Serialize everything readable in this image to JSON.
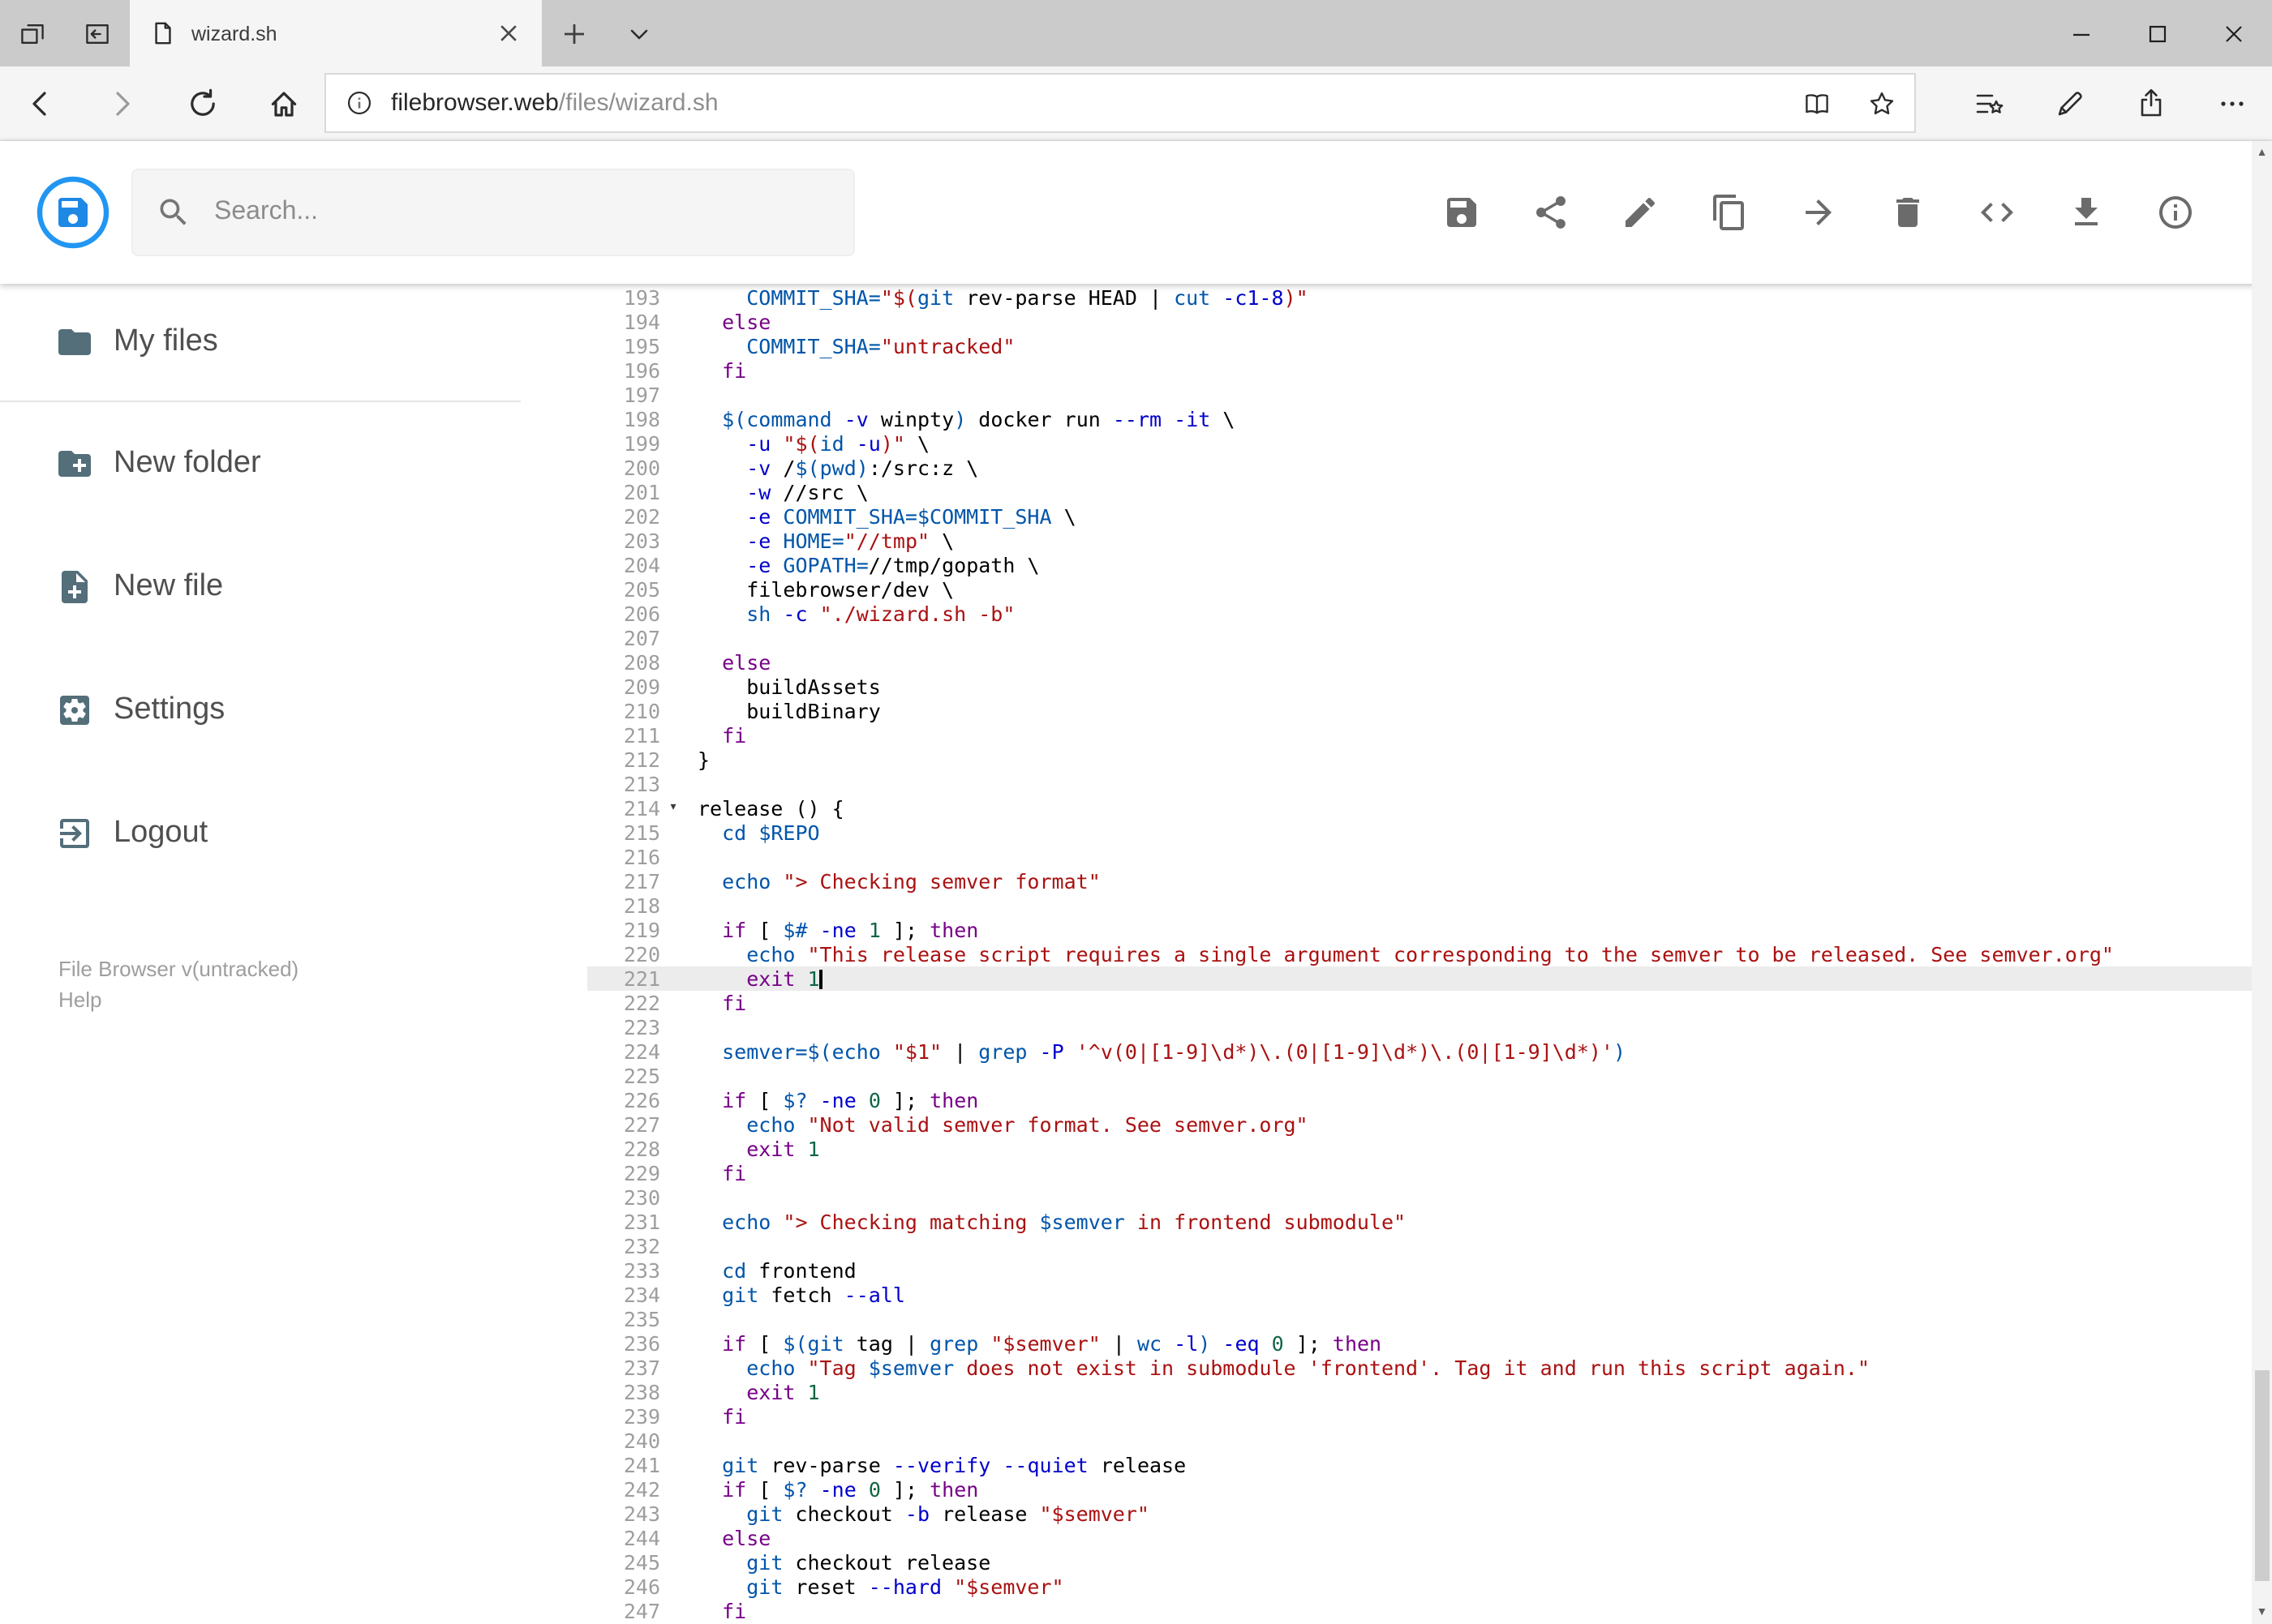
{
  "browser": {
    "tab_title": "wizard.sh",
    "url_host": "filebrowser.web",
    "url_path": "/files/wizard.sh"
  },
  "header": {
    "search_placeholder": "Search..."
  },
  "toolbar": {
    "icons": [
      "save",
      "share",
      "edit",
      "copy",
      "move",
      "delete",
      "code",
      "download",
      "info"
    ]
  },
  "sidebar": {
    "items": [
      {
        "label": "My files",
        "icon": "folder",
        "divider_after": true
      },
      {
        "label": "New folder",
        "icon": "create-new-folder",
        "divider_after": false
      },
      {
        "label": "New file",
        "icon": "note-add",
        "divider_after": false
      },
      {
        "label": "Settings",
        "icon": "settings",
        "divider_after": false
      },
      {
        "label": "Logout",
        "icon": "logout",
        "divider_after": false
      }
    ],
    "footer": {
      "version": "File Browser v(untracked)",
      "help": "Help"
    }
  },
  "colors": {
    "brand_blue": "#2196f3",
    "active_line_bg": "#ececec"
  },
  "editor": {
    "active_line": 221,
    "fold_line": 214,
    "cursor_line": 221,
    "lines": [
      {
        "n": 193,
        "t": [
          [
            "pl",
            "    "
          ],
          [
            "vr",
            "COMMIT_SHA="
          ],
          [
            "st",
            "\"$("
          ],
          [
            "bi",
            "git"
          ],
          [
            "pl",
            " rev-parse HEAD | "
          ],
          [
            "bi",
            "cut"
          ],
          [
            "pl",
            " "
          ],
          [
            "at",
            "-c1-8"
          ],
          [
            "st",
            ")\""
          ]
        ]
      },
      {
        "n": 194,
        "t": [
          [
            "pl",
            "  "
          ],
          [
            "kw",
            "else"
          ]
        ]
      },
      {
        "n": 195,
        "t": [
          [
            "pl",
            "    "
          ],
          [
            "vr",
            "COMMIT_SHA="
          ],
          [
            "st",
            "\"untracked\""
          ]
        ]
      },
      {
        "n": 196,
        "t": [
          [
            "pl",
            "  "
          ],
          [
            "kw",
            "fi"
          ]
        ]
      },
      {
        "n": 197,
        "t": []
      },
      {
        "n": 198,
        "t": [
          [
            "pl",
            "  "
          ],
          [
            "vr",
            "$("
          ],
          [
            "bi",
            "command"
          ],
          [
            "pl",
            " "
          ],
          [
            "at",
            "-v"
          ],
          [
            "pl",
            " winpty"
          ],
          [
            "vr",
            ")"
          ],
          [
            "pl",
            " docker run "
          ],
          [
            "at",
            "--rm"
          ],
          [
            "pl",
            " "
          ],
          [
            "at",
            "-it"
          ],
          [
            "pl",
            " \\"
          ]
        ]
      },
      {
        "n": 199,
        "t": [
          [
            "pl",
            "    "
          ],
          [
            "at",
            "-u"
          ],
          [
            "pl",
            " "
          ],
          [
            "st",
            "\"$("
          ],
          [
            "bi",
            "id"
          ],
          [
            "pl",
            " "
          ],
          [
            "at",
            "-u"
          ],
          [
            "st",
            ")\""
          ],
          [
            "pl",
            " \\"
          ]
        ]
      },
      {
        "n": 200,
        "t": [
          [
            "pl",
            "    "
          ],
          [
            "at",
            "-v"
          ],
          [
            "pl",
            " /"
          ],
          [
            "vr",
            "$("
          ],
          [
            "bi",
            "pwd"
          ],
          [
            "vr",
            ")"
          ],
          [
            "pl",
            ":/src:z \\"
          ]
        ]
      },
      {
        "n": 201,
        "t": [
          [
            "pl",
            "    "
          ],
          [
            "at",
            "-w"
          ],
          [
            "pl",
            " //src \\"
          ]
        ]
      },
      {
        "n": 202,
        "t": [
          [
            "pl",
            "    "
          ],
          [
            "at",
            "-e"
          ],
          [
            "pl",
            " "
          ],
          [
            "vr",
            "COMMIT_SHA=$COMMIT_SHA"
          ],
          [
            "pl",
            " \\"
          ]
        ]
      },
      {
        "n": 203,
        "t": [
          [
            "pl",
            "    "
          ],
          [
            "at",
            "-e"
          ],
          [
            "pl",
            " "
          ],
          [
            "vr",
            "HOME="
          ],
          [
            "st",
            "\"//tmp\""
          ],
          [
            "pl",
            " \\"
          ]
        ]
      },
      {
        "n": 204,
        "t": [
          [
            "pl",
            "    "
          ],
          [
            "at",
            "-e"
          ],
          [
            "pl",
            " "
          ],
          [
            "vr",
            "GOPATH="
          ],
          [
            "pl",
            "//tmp/gopath \\"
          ]
        ]
      },
      {
        "n": 205,
        "t": [
          [
            "pl",
            "    filebrowser/dev \\"
          ]
        ]
      },
      {
        "n": 206,
        "t": [
          [
            "pl",
            "    "
          ],
          [
            "bi",
            "sh"
          ],
          [
            "pl",
            " "
          ],
          [
            "at",
            "-c"
          ],
          [
            "pl",
            " "
          ],
          [
            "st",
            "\"./wizard.sh -b\""
          ]
        ]
      },
      {
        "n": 207,
        "t": []
      },
      {
        "n": 208,
        "t": [
          [
            "pl",
            "  "
          ],
          [
            "kw",
            "else"
          ]
        ]
      },
      {
        "n": 209,
        "t": [
          [
            "pl",
            "    buildAssets"
          ]
        ]
      },
      {
        "n": 210,
        "t": [
          [
            "pl",
            "    buildBinary"
          ]
        ]
      },
      {
        "n": 211,
        "t": [
          [
            "pl",
            "  "
          ],
          [
            "kw",
            "fi"
          ]
        ]
      },
      {
        "n": 212,
        "t": [
          [
            "pl",
            "}"
          ]
        ]
      },
      {
        "n": 213,
        "t": []
      },
      {
        "n": 214,
        "t": [
          [
            "pl",
            "release () {"
          ]
        ]
      },
      {
        "n": 215,
        "t": [
          [
            "pl",
            "  "
          ],
          [
            "bi",
            "cd"
          ],
          [
            "pl",
            " "
          ],
          [
            "vr",
            "$REPO"
          ]
        ]
      },
      {
        "n": 216,
        "t": []
      },
      {
        "n": 217,
        "t": [
          [
            "pl",
            "  "
          ],
          [
            "bi",
            "echo"
          ],
          [
            "pl",
            " "
          ],
          [
            "st",
            "\"> Checking semver format\""
          ]
        ]
      },
      {
        "n": 218,
        "t": []
      },
      {
        "n": 219,
        "t": [
          [
            "pl",
            "  "
          ],
          [
            "kw",
            "if"
          ],
          [
            "pl",
            " [ "
          ],
          [
            "vr",
            "$#"
          ],
          [
            "pl",
            " "
          ],
          [
            "at",
            "-ne"
          ],
          [
            "pl",
            " "
          ],
          [
            "nu",
            "1"
          ],
          [
            "pl",
            " ]; "
          ],
          [
            "kw",
            "then"
          ]
        ]
      },
      {
        "n": 220,
        "t": [
          [
            "pl",
            "    "
          ],
          [
            "bi",
            "echo"
          ],
          [
            "pl",
            " "
          ],
          [
            "st",
            "\"This release script requires a single argument corresponding to the semver to be released. See semver.org\""
          ]
        ]
      },
      {
        "n": 221,
        "t": [
          [
            "pl",
            "    "
          ],
          [
            "kw",
            "exit"
          ],
          [
            "pl",
            " "
          ],
          [
            "nu",
            "1"
          ]
        ]
      },
      {
        "n": 222,
        "t": [
          [
            "pl",
            "  "
          ],
          [
            "kw",
            "fi"
          ]
        ]
      },
      {
        "n": 223,
        "t": []
      },
      {
        "n": 224,
        "t": [
          [
            "pl",
            "  "
          ],
          [
            "vr",
            "semver=$("
          ],
          [
            "bi",
            "echo"
          ],
          [
            "pl",
            " "
          ],
          [
            "st",
            "\"$1\""
          ],
          [
            "pl",
            " | "
          ],
          [
            "bi",
            "grep"
          ],
          [
            "pl",
            " "
          ],
          [
            "at",
            "-P"
          ],
          [
            "pl",
            " "
          ],
          [
            "st",
            "'^v(0|[1-9]\\d*)\\.(0|[1-9]\\d*)\\.(0|[1-9]\\d*)'"
          ],
          [
            "vr",
            ")"
          ]
        ]
      },
      {
        "n": 225,
        "t": []
      },
      {
        "n": 226,
        "t": [
          [
            "pl",
            "  "
          ],
          [
            "kw",
            "if"
          ],
          [
            "pl",
            " [ "
          ],
          [
            "vr",
            "$?"
          ],
          [
            "pl",
            " "
          ],
          [
            "at",
            "-ne"
          ],
          [
            "pl",
            " "
          ],
          [
            "nu",
            "0"
          ],
          [
            "pl",
            " ]; "
          ],
          [
            "kw",
            "then"
          ]
        ]
      },
      {
        "n": 227,
        "t": [
          [
            "pl",
            "    "
          ],
          [
            "bi",
            "echo"
          ],
          [
            "pl",
            " "
          ],
          [
            "st",
            "\"Not valid semver format. See semver.org\""
          ]
        ]
      },
      {
        "n": 228,
        "t": [
          [
            "pl",
            "    "
          ],
          [
            "kw",
            "exit"
          ],
          [
            "pl",
            " "
          ],
          [
            "nu",
            "1"
          ]
        ]
      },
      {
        "n": 229,
        "t": [
          [
            "pl",
            "  "
          ],
          [
            "kw",
            "fi"
          ]
        ]
      },
      {
        "n": 230,
        "t": []
      },
      {
        "n": 231,
        "t": [
          [
            "pl",
            "  "
          ],
          [
            "bi",
            "echo"
          ],
          [
            "pl",
            " "
          ],
          [
            "st",
            "\"> Checking matching "
          ],
          [
            "vr",
            "$semver"
          ],
          [
            "st",
            " in frontend submodule\""
          ]
        ]
      },
      {
        "n": 232,
        "t": []
      },
      {
        "n": 233,
        "t": [
          [
            "pl",
            "  "
          ],
          [
            "bi",
            "cd"
          ],
          [
            "pl",
            " frontend"
          ]
        ]
      },
      {
        "n": 234,
        "t": [
          [
            "pl",
            "  "
          ],
          [
            "bi",
            "git"
          ],
          [
            "pl",
            " fetch "
          ],
          [
            "at",
            "--all"
          ]
        ]
      },
      {
        "n": 235,
        "t": []
      },
      {
        "n": 236,
        "t": [
          [
            "pl",
            "  "
          ],
          [
            "kw",
            "if"
          ],
          [
            "pl",
            " [ "
          ],
          [
            "vr",
            "$("
          ],
          [
            "bi",
            "git"
          ],
          [
            "pl",
            " tag | "
          ],
          [
            "bi",
            "grep"
          ],
          [
            "pl",
            " "
          ],
          [
            "st",
            "\"$semver\""
          ],
          [
            "pl",
            " | "
          ],
          [
            "bi",
            "wc"
          ],
          [
            "pl",
            " "
          ],
          [
            "at",
            "-l"
          ],
          [
            "vr",
            ")"
          ],
          [
            "pl",
            " "
          ],
          [
            "at",
            "-eq"
          ],
          [
            "pl",
            " "
          ],
          [
            "nu",
            "0"
          ],
          [
            "pl",
            " ]; "
          ],
          [
            "kw",
            "then"
          ]
        ]
      },
      {
        "n": 237,
        "t": [
          [
            "pl",
            "    "
          ],
          [
            "bi",
            "echo"
          ],
          [
            "pl",
            " "
          ],
          [
            "st",
            "\"Tag "
          ],
          [
            "vr",
            "$semver"
          ],
          [
            "st",
            " does not exist in submodule 'frontend'. Tag it and run this script again.\""
          ]
        ]
      },
      {
        "n": 238,
        "t": [
          [
            "pl",
            "    "
          ],
          [
            "kw",
            "exit"
          ],
          [
            "pl",
            " "
          ],
          [
            "nu",
            "1"
          ]
        ]
      },
      {
        "n": 239,
        "t": [
          [
            "pl",
            "  "
          ],
          [
            "kw",
            "fi"
          ]
        ]
      },
      {
        "n": 240,
        "t": []
      },
      {
        "n": 241,
        "t": [
          [
            "pl",
            "  "
          ],
          [
            "bi",
            "git"
          ],
          [
            "pl",
            " rev-parse "
          ],
          [
            "at",
            "--verify"
          ],
          [
            "pl",
            " "
          ],
          [
            "at",
            "--quiet"
          ],
          [
            "pl",
            " release"
          ]
        ]
      },
      {
        "n": 242,
        "t": [
          [
            "pl",
            "  "
          ],
          [
            "kw",
            "if"
          ],
          [
            "pl",
            " [ "
          ],
          [
            "vr",
            "$?"
          ],
          [
            "pl",
            " "
          ],
          [
            "at",
            "-ne"
          ],
          [
            "pl",
            " "
          ],
          [
            "nu",
            "0"
          ],
          [
            "pl",
            " ]; "
          ],
          [
            "kw",
            "then"
          ]
        ]
      },
      {
        "n": 243,
        "t": [
          [
            "pl",
            "    "
          ],
          [
            "bi",
            "git"
          ],
          [
            "pl",
            " checkout "
          ],
          [
            "at",
            "-b"
          ],
          [
            "pl",
            " release "
          ],
          [
            "st",
            "\"$semver\""
          ]
        ]
      },
      {
        "n": 244,
        "t": [
          [
            "pl",
            "  "
          ],
          [
            "kw",
            "else"
          ]
        ]
      },
      {
        "n": 245,
        "t": [
          [
            "pl",
            "    "
          ],
          [
            "bi",
            "git"
          ],
          [
            "pl",
            " checkout release"
          ]
        ]
      },
      {
        "n": 246,
        "t": [
          [
            "pl",
            "    "
          ],
          [
            "bi",
            "git"
          ],
          [
            "pl",
            " reset "
          ],
          [
            "at",
            "--hard"
          ],
          [
            "pl",
            " "
          ],
          [
            "st",
            "\"$semver\""
          ]
        ]
      },
      {
        "n": 247,
        "t": [
          [
            "pl",
            "  "
          ],
          [
            "kw",
            "fi"
          ]
        ]
      }
    ]
  }
}
